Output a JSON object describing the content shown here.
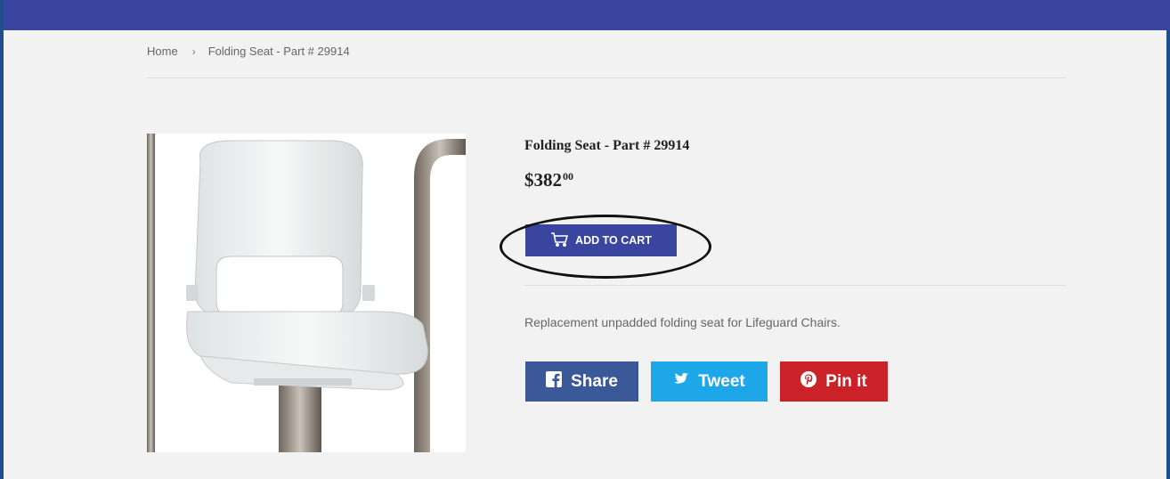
{
  "breadcrumb": {
    "home": "Home",
    "separator": "›",
    "current": "Folding Seat - Part # 29914"
  },
  "product": {
    "title": "Folding Seat - Part # 29914",
    "price_main": "$382",
    "price_cents": "00",
    "description": "Replacement unpadded folding seat for Lifeguard Chairs.",
    "image_icon": "folding-seat-photo"
  },
  "cart": {
    "label": "ADD TO CART",
    "icon": "cart-icon"
  },
  "social": {
    "share_label": "Share",
    "tweet_label": "Tweet",
    "pin_label": "Pin it"
  },
  "colors": {
    "brand": "#3a45a0",
    "facebook": "#3b5998",
    "twitter": "#1ea7e8",
    "pinterest": "#cb2128"
  }
}
